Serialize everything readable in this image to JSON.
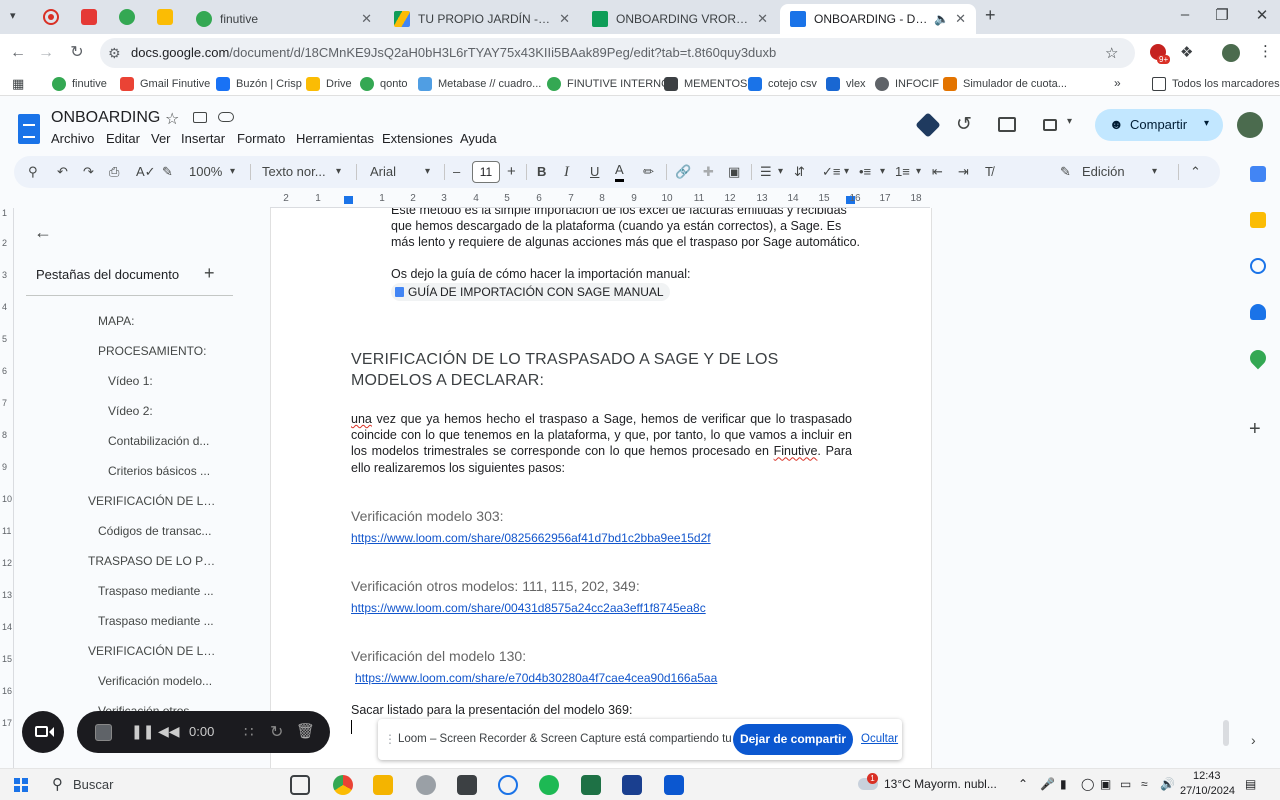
{
  "browser": {
    "tabs": [
      {
        "title": "finutive",
        "active": false
      },
      {
        "title": "TU PROPIO JARDÍN - Google D",
        "active": false
      },
      {
        "title": "ONBOARDING VRORR - Hojas c",
        "active": false
      },
      {
        "title": "ONBOARDING - Document",
        "active": true
      }
    ],
    "url_host": "docs.google.com",
    "url_path": "/document/d/18CMnKE9JsQ2aH0bH3L6rTYAY75x43KIIi5BAak89Peg/edit?tab=t.8t60quy3duxb",
    "bookmarks": [
      "finutive",
      "Gmail Finutive",
      "Buzón | Crisp",
      "Drive",
      "qonto",
      "Metabase // cuadro...",
      "FINUTIVE INTERNO",
      "MEMENTOS",
      "cotejo csv",
      "vlex",
      "INFOCIF",
      "Simulador de cuota..."
    ],
    "all_bookmarks": "Todos los marcadores",
    "ext_badge": "9+"
  },
  "docs": {
    "title": "ONBOARDING",
    "menu": [
      "Archivo",
      "Editar",
      "Ver",
      "Insertar",
      "Formato",
      "Herramientas",
      "Extensiones",
      "Ayuda"
    ],
    "share_label": "Compartir",
    "toolbar": {
      "zoom": "100%",
      "style": "Texto nor...",
      "font": "Arial",
      "font_size": "11",
      "mode": "Edición"
    },
    "ruler_ticks": [
      "2",
      "1",
      "1",
      "2",
      "3",
      "4",
      "5",
      "6",
      "7",
      "8",
      "9",
      "10",
      "11",
      "12",
      "13",
      "14",
      "15",
      "16",
      "17",
      "18"
    ],
    "vruler_ticks": [
      "1",
      "2",
      "3",
      "4",
      "5",
      "6",
      "7",
      "8",
      "9",
      "10",
      "11",
      "12",
      "13",
      "14",
      "15",
      "16",
      "17"
    ]
  },
  "sidebar": {
    "title": "Pestañas del documento",
    "items": [
      {
        "label": "MAPA:",
        "level": 2
      },
      {
        "label": "PROCESAMIENTO:",
        "level": 2
      },
      {
        "label": "Vídeo 1:",
        "level": 3
      },
      {
        "label": "Vídeo 2:",
        "level": 3
      },
      {
        "label": "Contabilización d...",
        "level": 3
      },
      {
        "label": "Criterios básicos ...",
        "level": 3
      },
      {
        "label": "VERIFICACIÓN DE LO...",
        "level": 1
      },
      {
        "label": "Códigos de transac...",
        "level": 2
      },
      {
        "label": "TRASPASO DE LO PR...",
        "level": 1
      },
      {
        "label": "Traspaso mediante ...",
        "level": 2
      },
      {
        "label": "Traspaso mediante ...",
        "level": 2
      },
      {
        "label": "VERIFICACIÓN DE LO...",
        "level": 1
      },
      {
        "label": "Verificación modelo...",
        "level": 2
      },
      {
        "label": "Verificación otros ...",
        "level": 2
      }
    ]
  },
  "content": {
    "intro_l1": "Este método es la simple importación de los excel de facturas emitidas y recibidas",
    "intro_l2": "que hemos descargado de la plataforma (cuando ya están correctos), a Sage. Es",
    "intro_l3": "más lento y requiere de algunas acciones más que el traspaso por Sage automático.",
    "guide_intro": "Os dejo la guía de cómo hacer la importación manual:",
    "guide_chip": "GUÍA DE IMPORTACIÓN CON SAGE MANUAL",
    "heading": "VERIFICACIÓN DE LO TRASPASADO A SAGE Y DE LOS MODELOS A DECLARAR:",
    "para_w1": "una",
    "para_a": " vez que ya hemos hecho el traspaso a Sage, hemos de verificar que lo traspasado coincide con lo que tenemos en la plataforma, y que, por tanto, lo que vamos a incluir en los modelos trimestrales se corresponde con lo que hemos procesado en ",
    "para_w2": "Finutive",
    "para_b": ". Para ello realizaremos los siguientes pasos:",
    "sec1_title": "Verificación modelo 303:",
    "sec1_link": "https://www.loom.com/share/0825662956af41d7bd1c2bba9ee15d2f",
    "sec2_title": "Verificación otros modelos: 111, 115, 202, 349:",
    "sec2_link": "https://www.loom.com/share/00431d8575a24cc2aa3eff1f8745ea8c",
    "sec3_title": "Verificación del modelo 130:",
    "sec3_link": "https://www.loom.com/share/e70d4b30280a4f7cae4cea90d166a5aa",
    "last_line": "Sacar listado para la presentación del modelo 369:"
  },
  "loom": {
    "timer": "0:00",
    "share_msg": "Loom – Screen Recorder & Screen Capture está compartiendo tu pantalla.",
    "stop_label": "Dejar de compartir",
    "hide_label": "Ocultar"
  },
  "taskbar": {
    "search_placeholder": "Buscar",
    "weather": "13°C  Mayorm. nubl...",
    "weather_badge": "1",
    "time": "12:43",
    "date": "27/10/2024"
  },
  "colors": {
    "accent": "#1a73e8",
    "share_bg": "#c2e7ff",
    "link": "#1155cc",
    "loom_button": "#0b57d0"
  }
}
